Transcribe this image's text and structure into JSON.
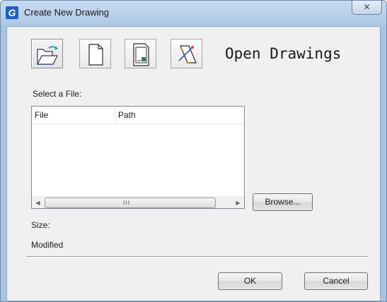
{
  "window": {
    "title": "Create New Drawing",
    "app_icon_glyph": "G",
    "close_glyph": "✕"
  },
  "toolbar": {
    "modes": [
      {
        "name": "open-drawings",
        "icon": "open-folder-icon",
        "active": true
      },
      {
        "name": "start-from-scratch",
        "icon": "blank-page-icon",
        "active": false
      },
      {
        "name": "use-template",
        "icon": "template-icon",
        "active": false
      },
      {
        "name": "use-wizard",
        "icon": "wizard-icon",
        "active": false
      }
    ],
    "mode_title": "Open Drawings"
  },
  "file_picker": {
    "select_label": "Select a File:",
    "columns": [
      "File",
      "Path"
    ],
    "rows": [],
    "scroll_grip": "III"
  },
  "buttons": {
    "browse": "Browse...",
    "ok": "OK",
    "cancel": "Cancel"
  },
  "info": {
    "size_label": "Size:",
    "modified_label": "Modified"
  },
  "colors": {
    "frame": "#a9c4e2",
    "client_bg": "#f0f0f0",
    "app_icon": "#1e5fc3"
  }
}
